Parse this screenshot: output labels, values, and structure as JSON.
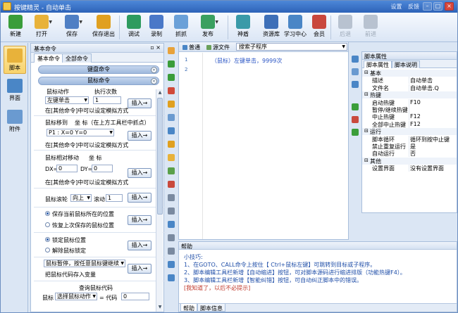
{
  "app": {
    "title": "按键精灵 - 自动单击",
    "settings": "设置",
    "feedback": "反馈"
  },
  "toolbar": [
    {
      "label": "新建",
      "icon": "new-file-icon",
      "color": "#3a9d3a"
    },
    {
      "label": "打开",
      "icon": "open-folder-icon",
      "color": "#e8b23a",
      "dropdown": true
    },
    {
      "label": "保存",
      "icon": "save-disk-icon",
      "color": "#4f7fc4",
      "dropdown": true
    },
    {
      "label": "保存退出",
      "icon": "save-exit-icon",
      "color": "#e0a020"
    },
    {
      "label": "调试",
      "icon": "debug-icon",
      "color": "#2e9b5f"
    },
    {
      "label": "录制",
      "icon": "record-icon",
      "color": "#4a78c8"
    },
    {
      "label": "抓抓",
      "icon": "grab-icon",
      "color": "#6aa0d8"
    },
    {
      "label": "发布",
      "icon": "publish-icon",
      "color": "#3aa060",
      "dropdown": true
    },
    {
      "label": "神盾",
      "icon": "shield-icon",
      "color": "#3a9aa8"
    },
    {
      "label": "资源库",
      "icon": "resource-library-icon",
      "color": "#3d6fb8"
    },
    {
      "label": "学习中心",
      "icon": "learning-center-icon",
      "color": "#4a86c6"
    },
    {
      "label": "会员",
      "icon": "member-icon",
      "color": "#c9473d"
    },
    {
      "label": "后退",
      "icon": "back-arrow-icon",
      "color": "#b8c2d0",
      "disabled": true
    },
    {
      "label": "前进",
      "icon": "forward-arrow-icon",
      "color": "#b8c2d0",
      "disabled": true
    }
  ],
  "leftnav": [
    {
      "label": "脚本",
      "icon": "script-icon",
      "selected": true
    },
    {
      "label": "界面",
      "icon": "interface-icon"
    },
    {
      "label": "附件",
      "icon": "attachment-icon"
    }
  ],
  "cmdpanel": {
    "title": "基本命令",
    "tabs": [
      "基本命令",
      "全部命令"
    ],
    "categories": [
      "键盘命令",
      "鼠标命令"
    ],
    "action_label": "鼠标动作",
    "count_label": "执行次数",
    "action_value": "左键单击",
    "count_value": "1",
    "hint1": "在[其他命令]中可以设定模拟方式",
    "insert": "插入→",
    "moveto_label": "鼠标移到",
    "coord_label": "坐 标（在上方工具栏中抓点）",
    "point_value": "P1 : X=0 Y=0",
    "hint2": "在[其他命令]中可以设定模拟方式",
    "relmove_label": "鼠标相对移动",
    "coord2": "坐 标",
    "dx_label": "DX=",
    "dx_value": "0",
    "dy_label": "DY=",
    "dy_value": "0",
    "hint3": "在[其他命令]中可以设定模拟方式",
    "wheel_label": "鼠标滚轮",
    "wheel_dir": "向上",
    "wheel_scroll": "滚动",
    "wheel_value": "1",
    "save_pos": "保存当前鼠标所在的位置",
    "restore_pos": "恢复上次保存的鼠标位置",
    "lock_pos": "锁定鼠标位置",
    "unlock_pos": "解除鼠标锁定",
    "pause_value": "鼠标暂停，按任意鼠标键继续",
    "code_to_var": "把鼠标代码存入变量",
    "query_code": "查询鼠标代码",
    "mouse_label": "鼠标",
    "choose_action": "选择鼠标动作",
    "eq_code": "= 代码",
    "code_value": "0"
  },
  "editor": {
    "tabs": [
      "普通",
      "源文件"
    ],
    "search_placeholder": "搜索子程序",
    "lines": [
      "1",
      "2"
    ],
    "code1": "（鼠标）左键单击，9999次"
  },
  "help": {
    "title": "帮助",
    "lines": [
      "小技巧:",
      "1、在GOTO、CALL命令上按住【 Ctrl+鼠标左键】可跳转到目标或子程序。",
      "2、脚本编辑工具栏新增【自动缩进】按钮，可对脚本源码进行缩进排版（功能热键F4）。",
      "3、脚本编辑工具栏新增【智能纠错】按钮，可自动纠正脚本中的错误。",
      "[我知道了，以后不必提示]"
    ],
    "tabs": [
      "帮助",
      "脚本信息"
    ],
    "link_color": "#c0392b",
    "text_color": "#1f4ea8"
  },
  "props": {
    "title": "脚本属性",
    "tabs": [
      "脚本属性",
      "脚本说明"
    ],
    "rows": [
      {
        "cat": true,
        "k": "基本"
      },
      {
        "k": "描述",
        "v": "自动单击"
      },
      {
        "k": "文件名",
        "v": "自动单击.Q"
      },
      {
        "cat": true,
        "k": "热键"
      },
      {
        "k": "启动热键",
        "v": "F10"
      },
      {
        "k": "暂停/继续热键",
        "v": ""
      },
      {
        "k": "中止热键",
        "v": "F12"
      },
      {
        "k": "全部中止热键",
        "v": "F12"
      },
      {
        "cat": true,
        "k": "运行"
      },
      {
        "k": "脚本循环",
        "v": "循环到按中止键"
      },
      {
        "k": "禁止重复运行",
        "v": "是"
      },
      {
        "k": "自动运行",
        "v": "否"
      },
      {
        "cat": true,
        "k": "其他"
      },
      {
        "k": "设置界面",
        "v": "没有设置界面"
      }
    ]
  }
}
